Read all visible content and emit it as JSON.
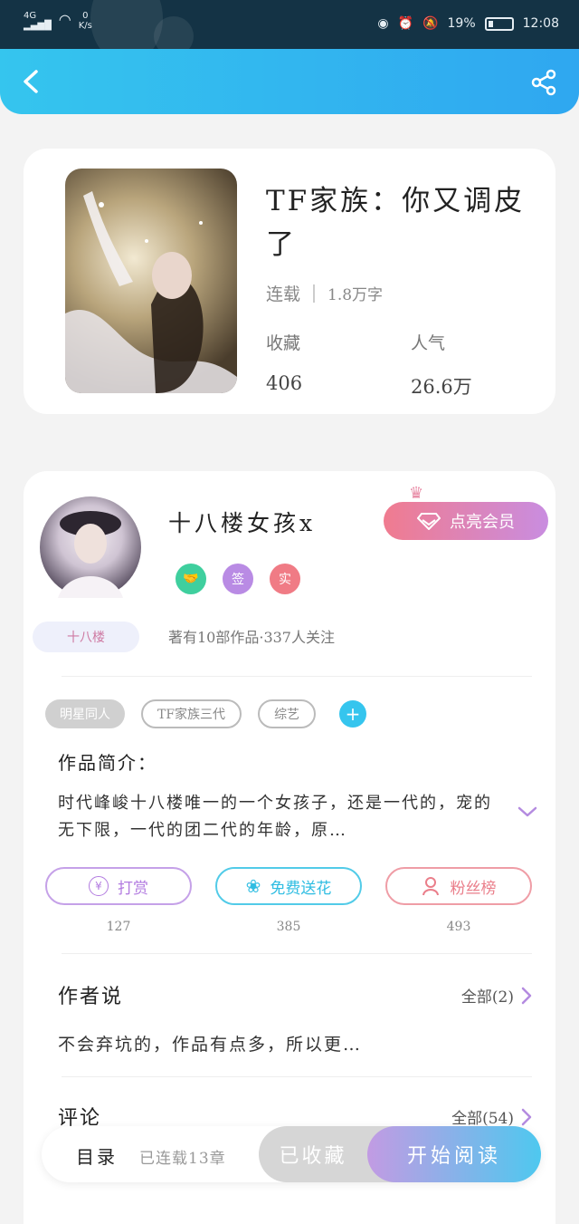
{
  "status_bar": {
    "network": "4G",
    "speed_value": "0",
    "speed_unit": "K/s",
    "battery": "19%",
    "time": "12:08"
  },
  "book": {
    "title": "TF家族：你又调皮了",
    "status": "连载",
    "word_count": "1.8万字",
    "collect_label": "收藏",
    "collect_value": "406",
    "popularity_label": "人气",
    "popularity_value": "26.6万"
  },
  "author": {
    "name": "十八楼女孩x",
    "vip_label": "点亮会员",
    "badges": [
      "签",
      "实"
    ],
    "level_tag": "十八楼",
    "works_summary": "著有10部作品·337人关注"
  },
  "tags": [
    "明星同人",
    "TF家族三代",
    "综艺"
  ],
  "intro": {
    "heading": "作品简介：",
    "text": "时代峰峻十八楼唯一的一个女孩子，还是一代的，宠的无下限，一代的团二代的年龄，原…"
  },
  "actions": [
    {
      "label": "打赏",
      "count": "127"
    },
    {
      "label": "免费送花",
      "count": "385"
    },
    {
      "label": "粉丝榜",
      "count": "493"
    }
  ],
  "author_says": {
    "title": "作者说",
    "more": "全部(2)",
    "text": "不会弃坑的，作品有点多，所以更…"
  },
  "comments": {
    "title": "评论",
    "more": "全部(54)"
  },
  "bottom_bar": {
    "toc": "目录",
    "serial": "已连载13章",
    "collected": "已收藏",
    "start_reading": "开始阅读"
  },
  "colors": {
    "header_gradient": [
      "#35c5ee",
      "#2fa7f0"
    ],
    "vip_gradient": [
      "#f07b8f",
      "#c98de0"
    ],
    "read_gradient": [
      "#c29be3",
      "#4ec8ef"
    ]
  }
}
